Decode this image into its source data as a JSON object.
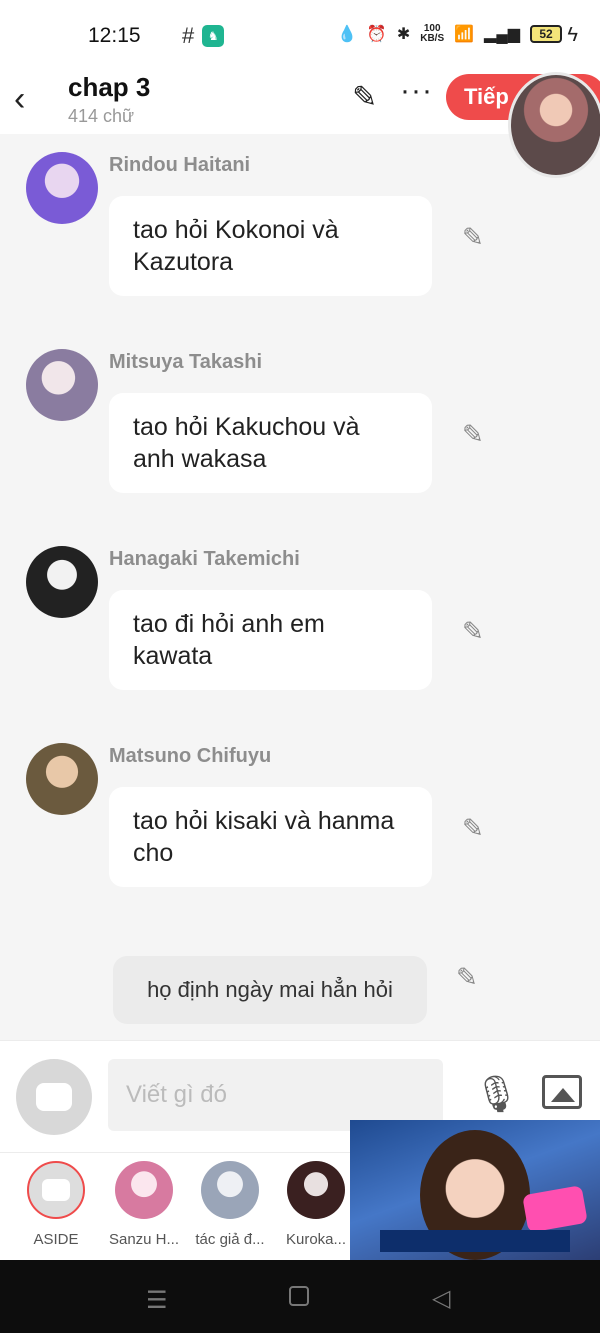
{
  "status_bar": {
    "time": "12:15",
    "grid_icon": "#",
    "net_speed_top": "100",
    "net_speed_bottom": "KB/S",
    "battery": "52"
  },
  "header": {
    "title": "chap 3",
    "subtitle": "414 chữ",
    "next_button": "Tiếp"
  },
  "messages": [
    {
      "name": "Rindou Haitani",
      "text": "tao hỏi Kokonoi và Kazutora",
      "avatar_color": "#7a5bd6"
    },
    {
      "name": "Mitsuya Takashi",
      "text": "tao hỏi Kakuchou và anh wakasa",
      "avatar_color": "#8a7ca0"
    },
    {
      "name": "Hanagaki Takemichi",
      "text": "tao đi hỏi anh em kawata",
      "avatar_color": "#222222"
    },
    {
      "name": "Matsuno Chifuyu",
      "text": "tao hỏi kisaki và hanma cho",
      "avatar_color": "#6b5a3e"
    }
  ],
  "aside_message": "họ định ngày mai hẳn hỏi",
  "composer": {
    "placeholder": "Viết gì đó"
  },
  "characters": [
    {
      "label": "ASIDE"
    },
    {
      "label": "Sanzu H...",
      "avatar_color": "#d77aa0"
    },
    {
      "label": "tác giả đ...",
      "avatar_color": "#9aa5b8"
    },
    {
      "label": "Kuroka...",
      "avatar_color": "#3a2020"
    }
  ],
  "colors": {
    "accent": "#ef4b4b",
    "background": "#f5f5f5"
  }
}
